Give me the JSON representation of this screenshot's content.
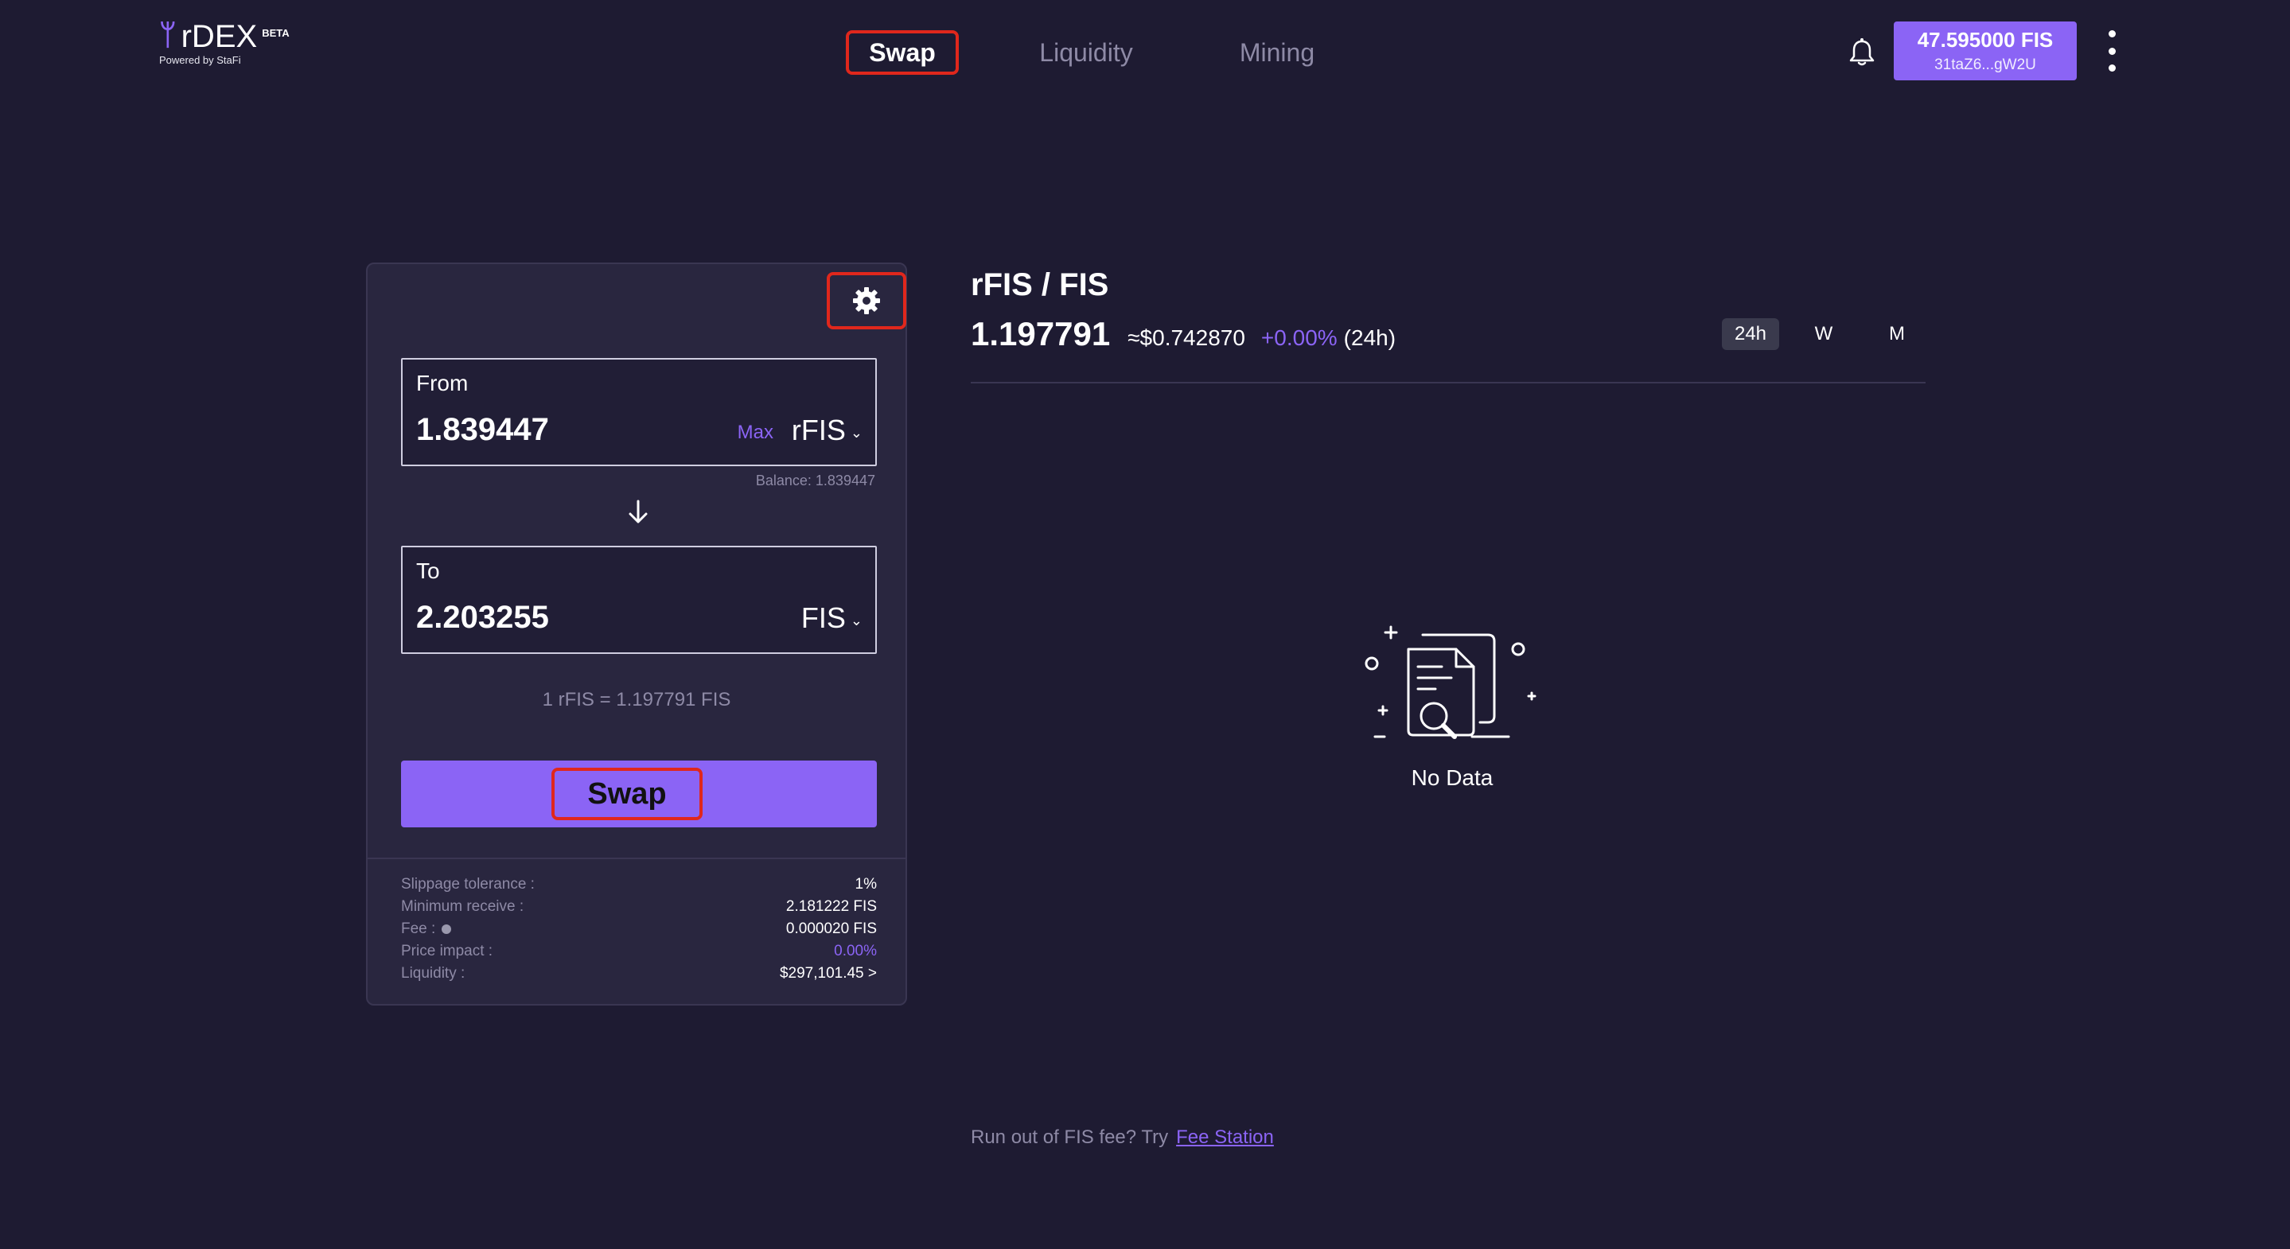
{
  "brand": {
    "mark": "ᛘ",
    "name": "rDEX",
    "badge": "BETA",
    "tagline": "Powered by StaFi"
  },
  "nav": {
    "items": [
      {
        "label": "Swap",
        "active": true
      },
      {
        "label": "Liquidity",
        "active": false
      },
      {
        "label": "Mining",
        "active": false
      }
    ]
  },
  "wallet": {
    "balance": "47.595000 FIS",
    "address": "31taZ6...gW2U"
  },
  "icons": {
    "bell": "bell-icon",
    "settings": "gear-icon",
    "arrow": "arrow-down-icon",
    "menu": "kebab-menu-icon",
    "empty": "no-data-document-icon"
  },
  "swap": {
    "from": {
      "label": "From",
      "amount": "1.839447",
      "max_label": "Max",
      "token": "rFIS",
      "balance": "Balance: 1.839447"
    },
    "to": {
      "label": "To",
      "amount": "2.203255",
      "token": "FIS"
    },
    "rate": "1 rFIS = 1.197791 FIS",
    "button_label": "Swap",
    "details": {
      "slippage_label": "Slippage tolerance :",
      "slippage_value": "1%",
      "min_receive_label": "Minimum receive :",
      "min_receive_value": "2.181222 FIS",
      "fee_label": "Fee :",
      "fee_value": "0.000020 FIS",
      "price_impact_label": "Price impact :",
      "price_impact_value": "0.00%",
      "liquidity_label": "Liquidity :",
      "liquidity_value": "$297,101.45 >"
    }
  },
  "chart": {
    "pair": "rFIS / FIS",
    "price": "1.197791",
    "usd_price": "≈$0.742870",
    "change": "+0.00%",
    "period": "(24h)",
    "ranges": [
      {
        "label": "24h",
        "active": true
      },
      {
        "label": "W",
        "active": false
      },
      {
        "label": "M",
        "active": false
      }
    ],
    "empty_text": "No Data"
  },
  "footer": {
    "note": "Run out of FIS fee? Try",
    "link": "Fee Station"
  },
  "colors": {
    "background": "#1e1b32",
    "card": "#29263f",
    "accent": "#8b64f5",
    "highlight": "#e0271c",
    "muted": "#8e8aa6"
  }
}
